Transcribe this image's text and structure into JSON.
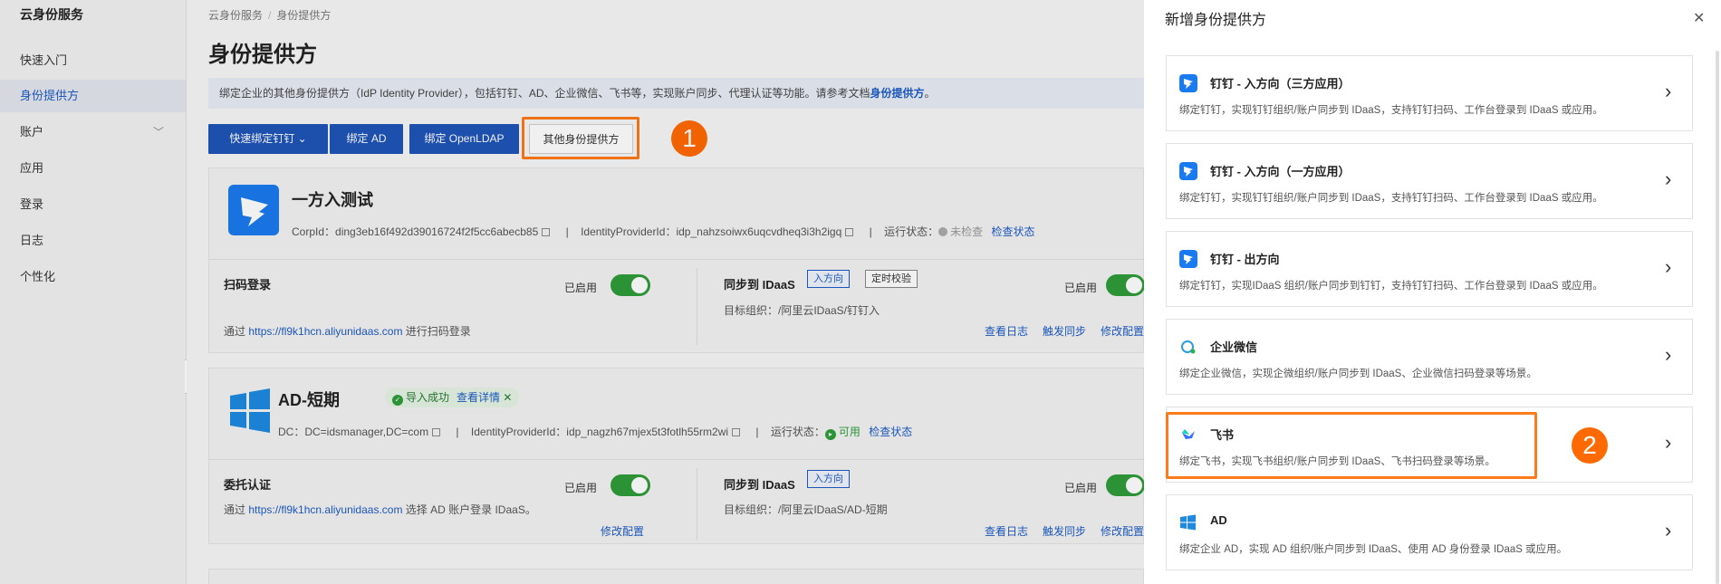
{
  "sidebar": {
    "title": "云身份服务",
    "items": [
      {
        "label": "快速入门"
      },
      {
        "label": "身份提供方"
      },
      {
        "label": "账户"
      },
      {
        "label": "应用"
      },
      {
        "label": "登录"
      },
      {
        "label": "日志"
      },
      {
        "label": "个性化"
      }
    ]
  },
  "breadcrumb": [
    "云身份服务",
    "身份提供方"
  ],
  "page_title": "身份提供方",
  "notice": {
    "text": "绑定企业的其他身份提供方（IdP Identity Provider），包括钉钉、AD、企业微信、飞书等，实现账户同步、代理认证等功能。请参考文档",
    "link": "身份提供方",
    "end": "。"
  },
  "toolbar": {
    "quick_bind": "快速绑定钉钉",
    "bind_ad": "绑定 AD",
    "bind_ldap": "绑定 OpenLDAP",
    "other": "其他身份提供方"
  },
  "annotations": {
    "step1": "1",
    "step2": "2"
  },
  "cards": [
    {
      "name": "一方入测试",
      "meta_id_label": "CorpId：",
      "meta_id": "ding3eb16f492d39016724f2f5cc6abecb85",
      "sep": "|",
      "idp_label": "IdentityProviderId：",
      "idp": "idp_nahzsoiwx6uqcvdheq3i3h2igq",
      "status_label": "运行状态：",
      "status": "未检查",
      "check": "检查状态",
      "left_title": "扫码登录",
      "left_enabled": "已启用",
      "left_prefix": "通过",
      "left_url": "https://fl9k1hcn.aliyunidaas.com",
      "left_suffix": "进行扫码登录",
      "right_title": "同步到 IDaaS",
      "tag1": "入方向",
      "tag2": "定时校验",
      "right_enabled": "已启用",
      "target": "目标组织：/阿里云IDaaS/钉钉入",
      "act1": "查看日志",
      "act2": "触发同步",
      "act3": "修改配置"
    },
    {
      "name": "AD-短期",
      "badge": "导入成功",
      "badge_link": "查看详情",
      "meta_id_label": "DC：",
      "meta_id": "DC=idsmanager,DC=com",
      "sep": "|",
      "idp_label": "IdentityProviderId：",
      "idp": "idp_nagzh67mjex5t3fotlh55rm2wi",
      "status_label": "运行状态：",
      "status": "可用",
      "check": "检查状态",
      "left_title": "委托认证",
      "left_enabled": "已启用",
      "left_prefix": "通过",
      "left_url": "https://fl9k1hcn.aliyunidaas.com",
      "left_suffix": "选择 AD 账户登录 IDaaS。",
      "left_action": "修改配置",
      "right_title": "同步到 IDaaS",
      "tag1": "入方向",
      "right_enabled": "已启用",
      "target": "目标组织：/阿里云IDaaS/AD-短期",
      "act1": "查看日志",
      "act2": "触发同步",
      "act3": "修改配置"
    }
  ],
  "panel": {
    "title": "新增身份提供方",
    "close": "✕",
    "providers": [
      {
        "title": "钉钉 - 入方向（三方应用）",
        "desc": "绑定钉钉，实现钉钉组织/账户同步到 IDaaS，支持钉钉扫码、工作台登录到 IDaaS 或应用。",
        "icon": "dingtalk-icon"
      },
      {
        "title": "钉钉 - 入方向（一方应用）",
        "desc": "绑定钉钉，实现钉钉组织/账户同步到 IDaaS，支持钉钉扫码、工作台登录到 IDaaS 或应用。",
        "icon": "dingtalk-icon"
      },
      {
        "title": "钉钉 - 出方向",
        "desc": "绑定钉钉，实现IDaaS 组织/账户同步到钉钉，支持钉钉扫码、工作台登录到 IDaaS 或应用。",
        "icon": "dingtalk-icon"
      },
      {
        "title": "企业微信",
        "desc": "绑定企业微信，实现企微组织/账户同步到 IDaaS、企业微信扫码登录等场景。",
        "icon": "wecom-icon"
      },
      {
        "title": "飞书",
        "desc": "绑定飞书，实现飞书组织/账户同步到 IDaaS、飞书扫码登录等场景。",
        "icon": "feishu-icon"
      },
      {
        "title": "AD",
        "desc": "绑定企业 AD，实现 AD 组织/账户同步到 IDaaS、使用 AD 身份登录 IDaaS 或应用。",
        "icon": "windows-icon"
      }
    ]
  },
  "colors": {
    "primary": "#1f56b8",
    "highlight": "#ff7a18",
    "success": "#2e9d3a",
    "link": "#1d5cc4"
  }
}
